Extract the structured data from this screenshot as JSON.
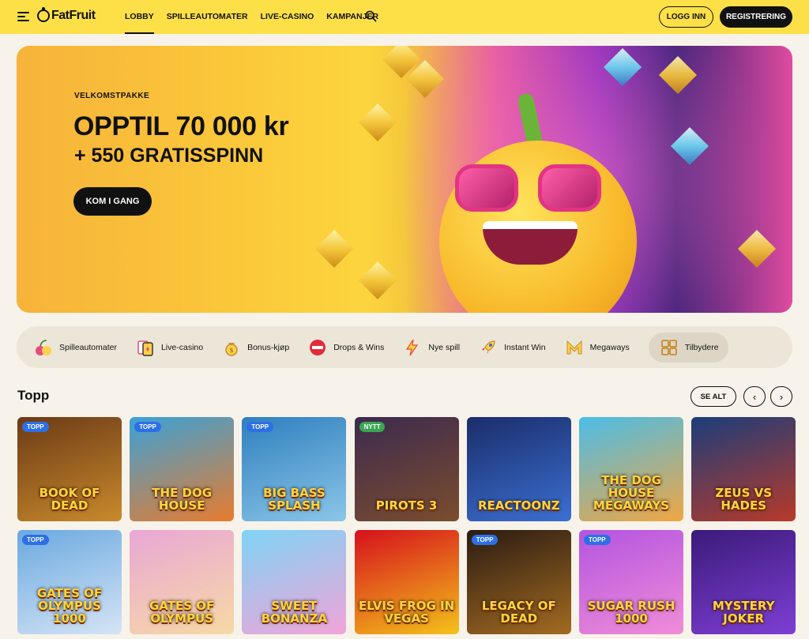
{
  "header": {
    "logo": "FatFruit",
    "nav": [
      "LOBBY",
      "SPILLEAUTOMATER",
      "LIVE-CASINO",
      "KAMPANJER"
    ],
    "login_label": "LOGG INN",
    "register_label": "REGISTRERING"
  },
  "hero": {
    "eyebrow": "VELKOMSTPAKKE",
    "title": "OPPTIL 70 000 kr",
    "subtitle": "+ 550 GRATISSPINN",
    "cta_label": "KOM I GANG"
  },
  "categories": [
    {
      "label": "Spilleautomater",
      "icon": "cherry-icon"
    },
    {
      "label": "Live-casino",
      "icon": "cards-icon"
    },
    {
      "label": "Bonus-kjøp",
      "icon": "money-bag-icon"
    },
    {
      "label": "Drops & Wins",
      "icon": "drops-wins-icon"
    },
    {
      "label": "Nye spill",
      "icon": "lightning-icon"
    },
    {
      "label": "Instant Win",
      "icon": "rocket-icon"
    },
    {
      "label": "Megaways",
      "icon": "megaways-icon"
    },
    {
      "label": "Tilbydere",
      "icon": "grid-icon"
    }
  ],
  "section": {
    "title": "Topp",
    "see_all_label": "SE ALT"
  },
  "games": [
    {
      "name": "Book of Dead",
      "badge": "TOPP",
      "colors": [
        "#6b3a16",
        "#c98a2c"
      ]
    },
    {
      "name": "The Dog House",
      "badge": "TOPP",
      "colors": [
        "#3aa2d8",
        "#e87b2e"
      ]
    },
    {
      "name": "Big Bass Splash",
      "badge": "TOPP",
      "colors": [
        "#2f7fbf",
        "#8bc6e8"
      ]
    },
    {
      "name": "Pirots 3",
      "badge": "NYTT",
      "colors": [
        "#3d2a4f",
        "#7b4d2e"
      ]
    },
    {
      "name": "Reactoonz",
      "badge": "",
      "colors": [
        "#1b2d6b",
        "#3b6fd1"
      ]
    },
    {
      "name": "The Dog House Megaways",
      "badge": "",
      "colors": [
        "#4bbde8",
        "#f0a642"
      ]
    },
    {
      "name": "Zeus vs Hades",
      "badge": "",
      "colors": [
        "#1b3d7a",
        "#b83a2a"
      ]
    },
    {
      "name": "Gates of Olympus 1000",
      "badge": "TOPP",
      "colors": [
        "#6aa9e0",
        "#d6e4f5"
      ]
    },
    {
      "name": "Gates of Olympus",
      "badge": "",
      "colors": [
        "#e9a7d6",
        "#f7d9a5"
      ]
    },
    {
      "name": "Sweet Bonanza",
      "badge": "",
      "colors": [
        "#7fd4f5",
        "#f2a4d8"
      ]
    },
    {
      "name": "Elvis Frog in Vegas",
      "badge": "",
      "colors": [
        "#d6101d",
        "#f4c21a"
      ]
    },
    {
      "name": "Legacy of Dead",
      "badge": "TOPP",
      "colors": [
        "#2a1b12",
        "#a36b22"
      ]
    },
    {
      "name": "Sugar Rush 1000",
      "badge": "TOPP",
      "colors": [
        "#b354e0",
        "#f08dd8"
      ]
    },
    {
      "name": "Mystery Joker",
      "badge": "",
      "colors": [
        "#3b1a7a",
        "#7e3fd4"
      ]
    }
  ]
}
